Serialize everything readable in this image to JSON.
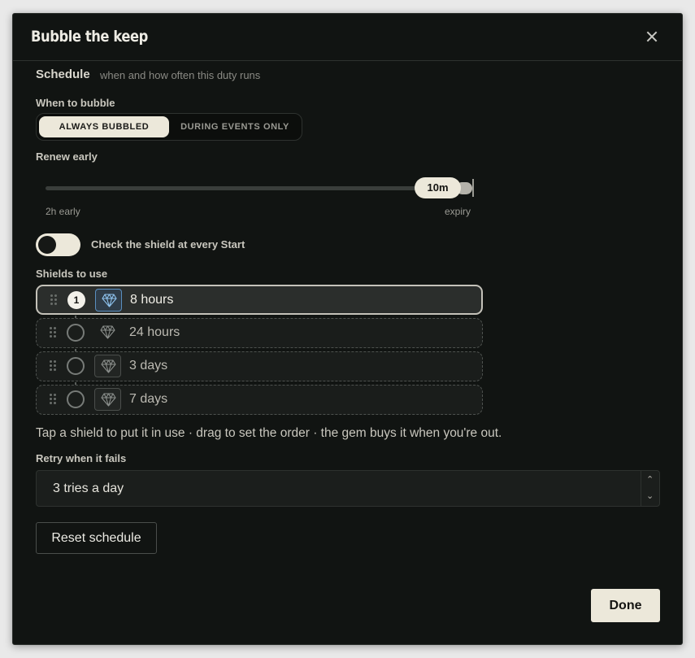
{
  "dialog": {
    "title": "Bubble the keep"
  },
  "schedule": {
    "title": "Schedule",
    "subtitle": "when and how often this duty runs"
  },
  "when_to_bubble": {
    "label": "When to bubble",
    "options": [
      "ALWAYS BUBBLED",
      "DURING EVENTS ONLY"
    ],
    "selected": "ALWAYS BUBBLED"
  },
  "renew_early": {
    "label": "Renew early",
    "value_label": "10m",
    "min_label": "2h early",
    "max_label": "expiry",
    "position_fraction": 0.94
  },
  "check_shield": {
    "label": "Check the shield at every Start",
    "on": false
  },
  "shields": {
    "label": "Shields to use",
    "items": [
      {
        "label": "8 hours",
        "order": "1",
        "active": true,
        "icon": "gem-icon"
      },
      {
        "label": "24 hours",
        "order": "",
        "active": false,
        "icon": "gem-icon"
      },
      {
        "label": "3 days",
        "order": "",
        "active": false,
        "icon": "gem-icon"
      },
      {
        "label": "7 days",
        "order": "",
        "active": false,
        "icon": "gem-icon"
      }
    ]
  },
  "hint": "Tap a shield to put it in use · drag to set the order · the gem buys it when you're out.",
  "retry": {
    "label": "Retry when it fails",
    "value": "3 tries a day"
  },
  "buttons": {
    "reset": "Reset schedule",
    "done": "Done"
  },
  "colors": {
    "accent": "#ece8da",
    "background": "#111412",
    "selected_gem": "#5a8fc0"
  }
}
